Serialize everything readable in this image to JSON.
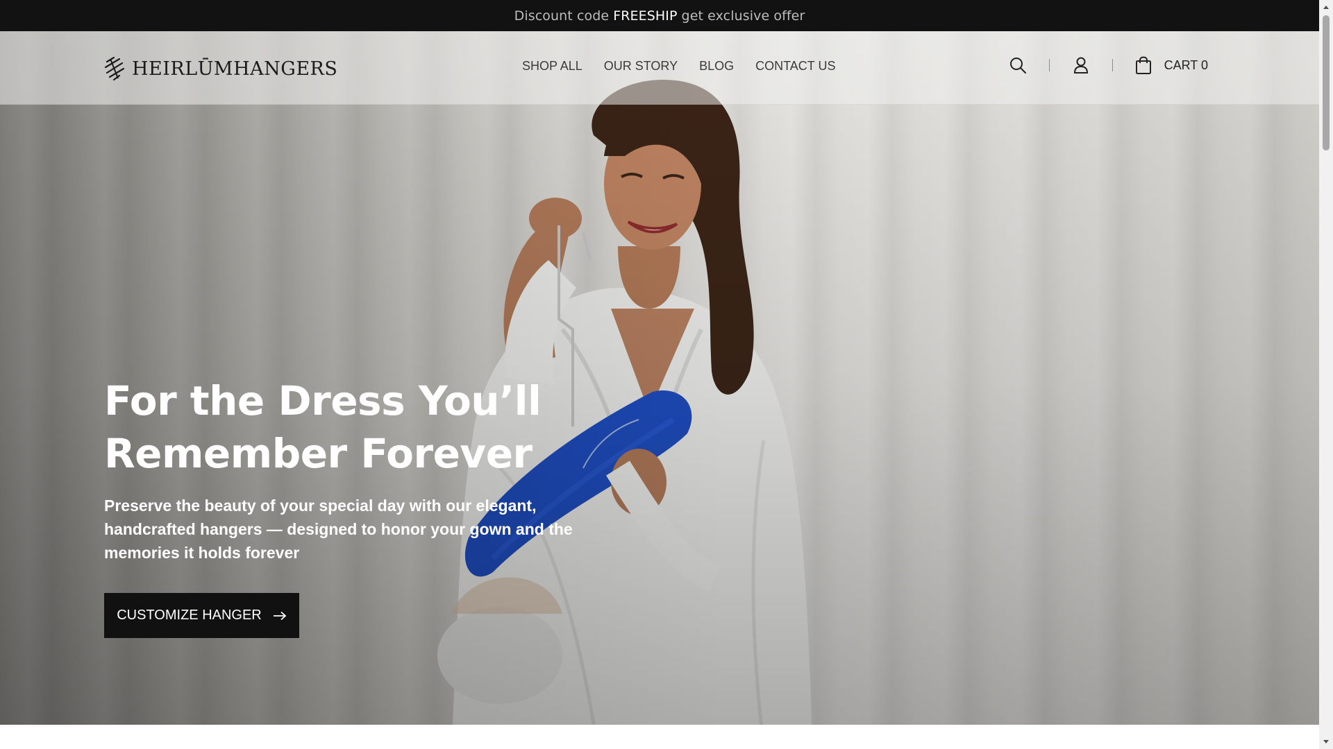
{
  "announcement": {
    "prefix": "Discount code",
    "code": "FREESHIP",
    "suffix": "get exclusive offer"
  },
  "header": {
    "logo_text": "HEIRLŪMHANGERS",
    "nav": [
      {
        "label": "SHOP ALL"
      },
      {
        "label": "OUR STORY"
      },
      {
        "label": "BLOG"
      },
      {
        "label": "CONTACT US"
      }
    ],
    "cart_label": "CART 0",
    "icons": [
      "search-icon",
      "account-icon",
      "cart-bag-icon"
    ]
  },
  "hero": {
    "title_line1": "For the Dress You’ll",
    "title_line2": "Remember Forever",
    "subtitle": "Preserve the beauty of your special day with our elegant, handcrafted hangers — designed to honor your gown and the memories it holds forever",
    "cta_label": "CUSTOMIZE HANGER",
    "cta_icon": "arrow-right-icon"
  },
  "colors": {
    "announcement_bg": "#121212",
    "cta_bg": "#111111",
    "hanger_blue": "#1f4fc4",
    "text_dark": "#3a3a3a"
  }
}
